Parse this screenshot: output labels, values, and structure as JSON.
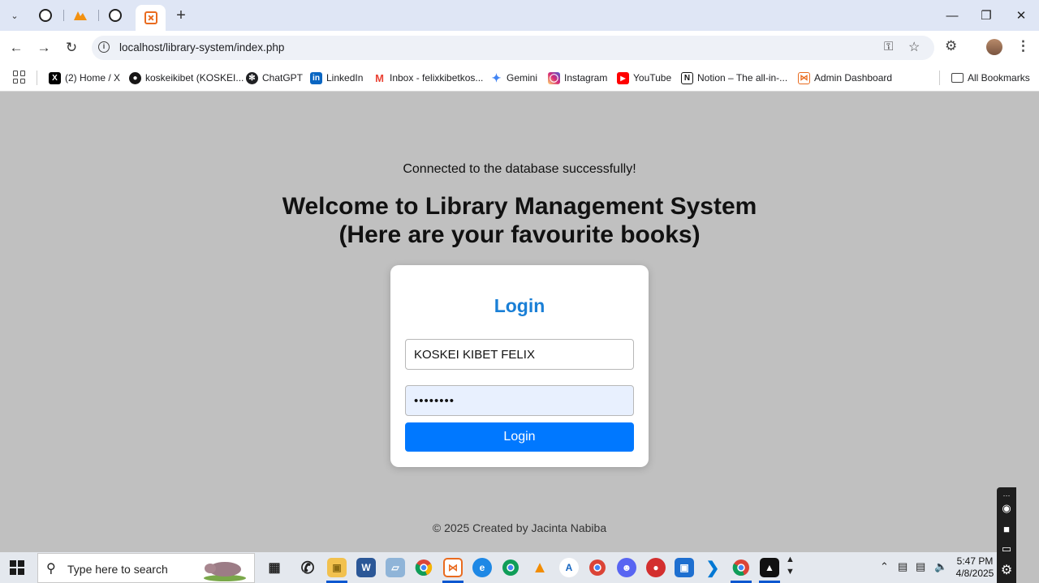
{
  "browser": {
    "url": "localhost/library-system/index.php",
    "tabs": [
      {
        "name": "chatgpt-tab",
        "icon": "openai-icon"
      },
      {
        "name": "pma-tab",
        "icon": "phpmyadmin-icon",
        "label": "PMA"
      },
      {
        "name": "chatgpt-tab-2",
        "icon": "openai-icon"
      },
      {
        "name": "xampp-tab",
        "icon": "xampp-icon",
        "active": true
      }
    ],
    "new_tab_symbol": "+",
    "window_controls": {
      "minimize": "—",
      "maximize": "❐",
      "close": "✕"
    }
  },
  "bookmarks": [
    {
      "label": "(2) Home / X",
      "icon": "x-icon",
      "color": "#000000"
    },
    {
      "label": "koskeikibet (KOSKEI...",
      "icon": "github-icon",
      "color": "#181717"
    },
    {
      "label": "ChatGPT",
      "icon": "openai-icon",
      "color": "#202124"
    },
    {
      "label": "LinkedIn",
      "icon": "linkedin-icon",
      "color": "#0a66c2"
    },
    {
      "label": "Inbox - felixkibetkos...",
      "icon": "gmail-icon",
      "color": "#ea4335"
    },
    {
      "label": "Gemini",
      "icon": "gemini-icon",
      "color": "#4285f4"
    },
    {
      "label": "Instagram",
      "icon": "instagram-icon",
      "color": "#d62976"
    },
    {
      "label": "YouTube",
      "icon": "youtube-icon",
      "color": "#ff0000"
    },
    {
      "label": "Notion – The all-in-...",
      "icon": "notion-icon",
      "color": "#111111"
    },
    {
      "label": "Admin Dashboard",
      "icon": "xampp-icon",
      "color": "#e96b1f"
    }
  ],
  "all_bookmarks_label": "All Bookmarks",
  "page": {
    "status_message": "Connected to the database successfully!",
    "heading_line1": "Welcome to Library Management System",
    "heading_line2": "(Here are your favourite books)",
    "login": {
      "title": "Login",
      "username_value": "KOSKEI KIBET FELIX",
      "password_value": "••••••••",
      "button_label": "Login"
    },
    "footer": "© 2025 Created by Jacinta Nabiba"
  },
  "taskbar": {
    "search_placeholder": "Type here to search",
    "time": "5:47 PM",
    "date": "4/8/2025",
    "accent": "#0b57d0"
  }
}
